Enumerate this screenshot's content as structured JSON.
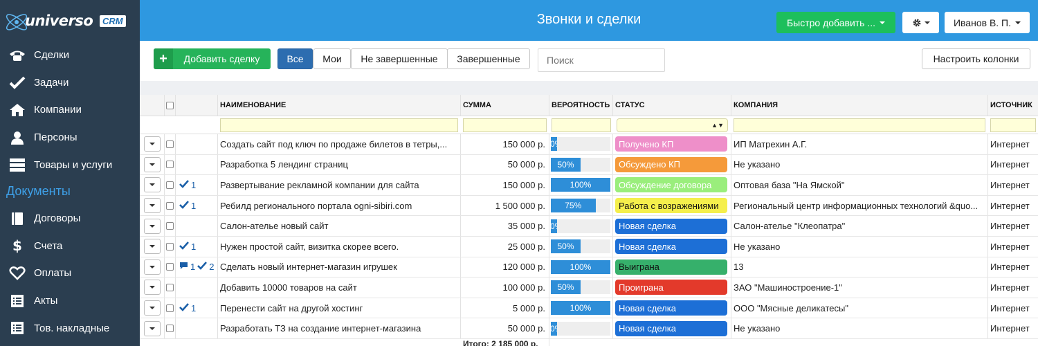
{
  "brand": {
    "word": "universo",
    "badge": "CRM"
  },
  "sidebar": {
    "items": [
      {
        "label": "Сделки",
        "icon": "phone-icon"
      },
      {
        "label": "Задачи",
        "icon": "check-icon"
      },
      {
        "label": "Компании",
        "icon": "home-icon"
      },
      {
        "label": "Персоны",
        "icon": "person-icon"
      },
      {
        "label": "Товары и услуги",
        "icon": "server-icon"
      }
    ],
    "section": "Документы",
    "doc_items": [
      {
        "label": "Договоры",
        "icon": "book-icon"
      },
      {
        "label": "Счета",
        "icon": "dollar-icon"
      },
      {
        "label": "Оплаты",
        "icon": "heart-icon"
      },
      {
        "label": "Акты",
        "icon": "list-icon"
      },
      {
        "label": "Тов. накладные",
        "icon": "list-icon"
      }
    ]
  },
  "header": {
    "title": "Звонки и сделки",
    "quick_add": "Быстро добавить ...",
    "user": "Иванов В. П."
  },
  "toolbar": {
    "add_deal": "Добавить сделку",
    "filters": [
      "Все",
      "Мои",
      "Не завершенные",
      "Завершенные"
    ],
    "active_filter": "Все",
    "search_placeholder": "Поиск",
    "configure_columns": "Настроить колонки"
  },
  "table": {
    "columns": [
      "НАИМЕНОВАНИЕ",
      "СУММА",
      "ВЕРОЯТНОСТЬ",
      "СТАТУС",
      "КОМПАНИЯ",
      "ИСТОЧНИК"
    ],
    "rows": [
      {
        "name": "Создать сайт под ключ по продаже билетов в тетры,...",
        "sum": "150 000 р.",
        "prob": 10,
        "prob_label": "10%",
        "status": "Получено КП",
        "status_color": "#ee8fc9",
        "status_text_color": "#ffffff",
        "company": "ИП Матрехин А.Г.",
        "source": "Интернет",
        "tasks": "",
        "comments": ""
      },
      {
        "name": "Разработка 5 лендинг страниц",
        "sum": "50 000 р.",
        "prob": 50,
        "prob_label": "50%",
        "status": "Обсуждено КП",
        "status_color": "#f59a3a",
        "status_text_color": "#ffffff",
        "company": "Не указано",
        "source": "Интернет",
        "tasks": "",
        "comments": ""
      },
      {
        "name": "Развертывание рекламной компании для сайта",
        "sum": "150 000 р.",
        "prob": 100,
        "prob_label": "100%",
        "status": "Обсуждение договора",
        "status_color": "#9aee7c",
        "status_text_color": "#ffffff",
        "company": "Оптовая база \"На Ямской\"",
        "source": "Интернет",
        "tasks": "1",
        "comments": ""
      },
      {
        "name": "Ребилд регионального портала ogni-sibiri.com",
        "sum": "1 500 000 р.",
        "prob": 75,
        "prob_label": "75%",
        "status": "Работа с возражениями",
        "status_color": "#f5ef4c",
        "status_text_color": "#111111",
        "company": "Региональный центр информационных технологий &quo...",
        "source": "Интернет",
        "tasks": "1",
        "comments": ""
      },
      {
        "name": "Салон-ателье новый сайт",
        "sum": "35 000 р.",
        "prob": 10,
        "prob_label": "10%",
        "status": "Новая сделка",
        "status_color": "#1d6fd6",
        "status_text_color": "#ffffff",
        "company": "Салон-ателье \"Клеопатра\"",
        "source": "Интернет",
        "tasks": "",
        "comments": ""
      },
      {
        "name": "Нужен простой сайт, визитка скорее всего.",
        "sum": "25 000 р.",
        "prob": 50,
        "prob_label": "50%",
        "status": "Новая сделка",
        "status_color": "#1d6fd6",
        "status_text_color": "#ffffff",
        "company": "Не указано",
        "source": "Интернет",
        "tasks": "1",
        "comments": ""
      },
      {
        "name": "Сделать новый интернет-магазин игрушек",
        "sum": "120 000 р.",
        "prob": 100,
        "prob_label": "100%",
        "status": "Выиграна",
        "status_color": "#36b06b",
        "status_text_color": "#111111",
        "company": "13",
        "source": "Интернет",
        "tasks": "2",
        "comments": "1"
      },
      {
        "name": "Добавить 10000 товаров на сайт",
        "sum": "100 000 р.",
        "prob": 50,
        "prob_label": "50%",
        "status": "Проиграна",
        "status_color": "#e33a2b",
        "status_text_color": "#ffffff",
        "company": "ЗАО \"Машиностроение-1\"",
        "source": "Интернет",
        "tasks": "",
        "comments": ""
      },
      {
        "name": "Перенести сайт на другой хостинг",
        "sum": "5 000 р.",
        "prob": 100,
        "prob_label": "100%",
        "status": "Новая сделка",
        "status_color": "#1d6fd6",
        "status_text_color": "#ffffff",
        "company": "ООО \"Мясные деликатесы\"",
        "source": "Интернет",
        "tasks": "1",
        "comments": ""
      },
      {
        "name": "Разработать ТЗ на создание интернет-магазина",
        "sum": "50 000 р.",
        "prob": 10,
        "prob_label": "10%",
        "status": "Новая сделка",
        "status_color": "#1d6fd6",
        "status_text_color": "#ffffff",
        "company": "Не указано",
        "source": "Интернет",
        "tasks": "",
        "comments": ""
      }
    ],
    "total": "Итого: 2 185 000 р."
  }
}
